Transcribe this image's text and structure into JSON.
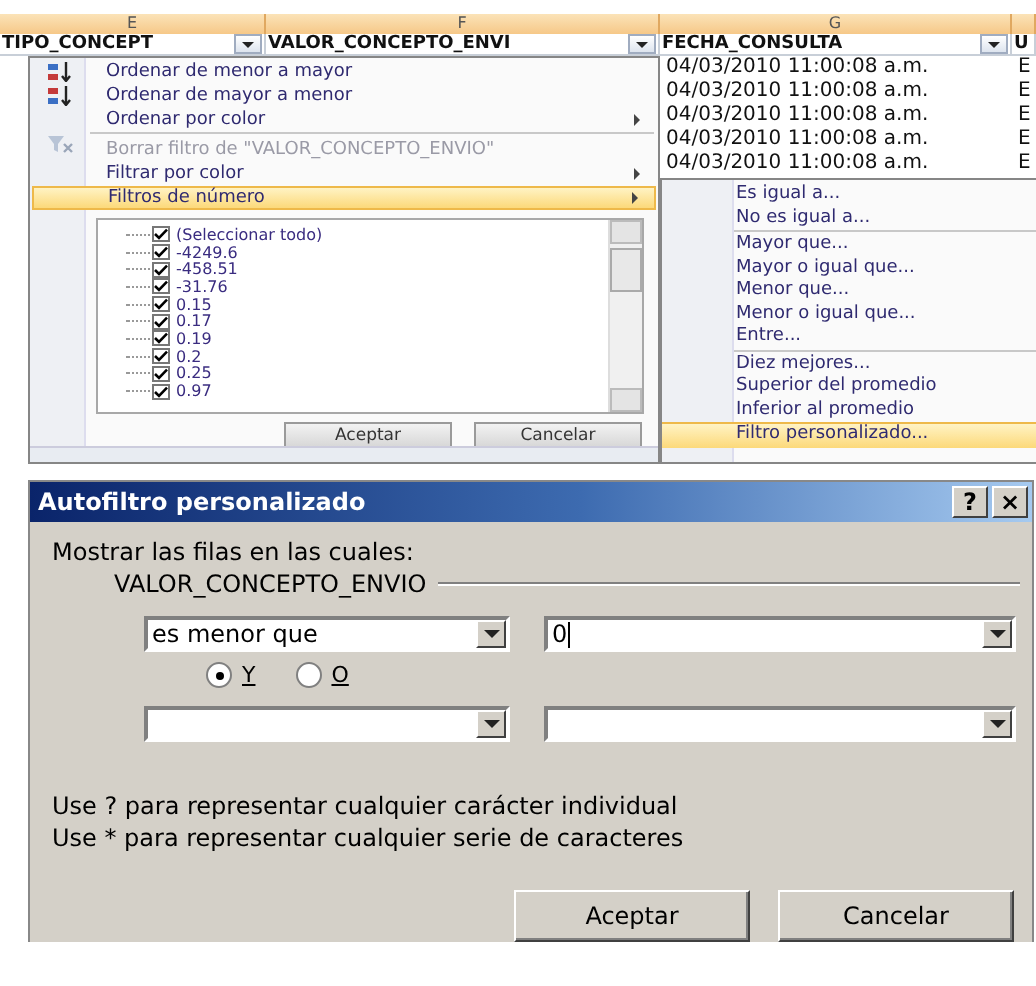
{
  "sheet": {
    "columns": [
      {
        "letter": "E",
        "header": "TIPO_CONCEPT",
        "filter": true
      },
      {
        "letter": "F",
        "header": "VALOR_CONCEPTO_ENVI",
        "filter": true
      },
      {
        "letter": "G",
        "header": "FECHA_CONSULTA",
        "filter": true
      },
      {
        "header": "U",
        "filter": false
      }
    ],
    "rows": [
      [
        "04/03/2010 11:00:08 a.m.",
        "E"
      ],
      [
        "04/03/2010 11:00:08 a.m.",
        "E"
      ],
      [
        "04/03/2010 11:00:08 a.m.",
        "E"
      ],
      [
        "04/03/2010 11:00:08 a.m.",
        "E"
      ],
      [
        "04/03/2010 11:00:08 a.m.",
        "E"
      ]
    ]
  },
  "filter_menu": {
    "items": [
      {
        "label": "Ordenar de menor a mayor",
        "kind": "sort-ascending",
        "separator_before": false,
        "disabled": false,
        "submenu": false,
        "selected": false
      },
      {
        "label": "Ordenar de mayor a menor",
        "kind": "sort-descending",
        "separator_before": false,
        "disabled": false,
        "submenu": false,
        "selected": false
      },
      {
        "label": "Ordenar por color",
        "separator_before": false,
        "disabled": false,
        "submenu": true,
        "selected": false
      },
      {
        "label": "Borrar filtro de \"VALOR_CONCEPTO_ENVIO\"",
        "kind": "clear-filter",
        "separator_before": true,
        "disabled": true,
        "submenu": false,
        "selected": false
      },
      {
        "label": "Filtrar por color",
        "separator_before": false,
        "disabled": false,
        "submenu": true,
        "selected": false
      },
      {
        "label": "Filtros de número",
        "separator_before": false,
        "disabled": false,
        "submenu": true,
        "selected": true
      }
    ],
    "values": [
      {
        "label": "(Seleccionar todo)",
        "checked": true
      },
      {
        "label": "-4249.6",
        "checked": true
      },
      {
        "label": "-458.51",
        "checked": true
      },
      {
        "label": "-31.76",
        "checked": true
      },
      {
        "label": "0.15",
        "checked": true
      },
      {
        "label": "0.17",
        "checked": true
      },
      {
        "label": "0.19",
        "checked": true
      },
      {
        "label": "0.2",
        "checked": true
      },
      {
        "label": "0.25",
        "checked": true
      },
      {
        "label": "0.97",
        "checked": true
      }
    ],
    "buttons": [
      "Aceptar",
      "Cancelar"
    ]
  },
  "number_filters_submenu": [
    {
      "label": "Es igual a...",
      "separator_before": false,
      "selected": false
    },
    {
      "label": "No es igual a...",
      "separator_before": false,
      "selected": false
    },
    {
      "label": "Mayor que...",
      "separator_before": true,
      "selected": false
    },
    {
      "label": "Mayor o igual que...",
      "separator_before": false,
      "selected": false
    },
    {
      "label": "Menor que...",
      "separator_before": false,
      "selected": false
    },
    {
      "label": "Menor o igual que...",
      "separator_before": false,
      "selected": false
    },
    {
      "label": "Entre...",
      "separator_before": false,
      "selected": false
    },
    {
      "label": "Diez mejores...",
      "separator_before": true,
      "selected": false
    },
    {
      "label": "Superior del promedio",
      "separator_before": false,
      "selected": false
    },
    {
      "label": "Inferior al promedio",
      "separator_before": false,
      "selected": false
    },
    {
      "label": "Filtro personalizado...",
      "separator_before": false,
      "selected": true
    }
  ],
  "dialog": {
    "title": "Autofiltro personalizado",
    "help_button": "?",
    "close_button": "×",
    "intro": "Mostrar las filas en las cuales:",
    "field": "VALOR_CONCEPTO_ENVIO",
    "condition_1": {
      "operator": "es menor que",
      "value": "0"
    },
    "logic": [
      {
        "label": "Y",
        "selected": true
      },
      {
        "label": "O",
        "selected": false
      }
    ],
    "hints": [
      "Use ? para representar cualquier carácter individual",
      "Use * para representar cualquier serie de caracteres"
    ],
    "buttons": [
      "Aceptar",
      "Cancelar"
    ]
  }
}
